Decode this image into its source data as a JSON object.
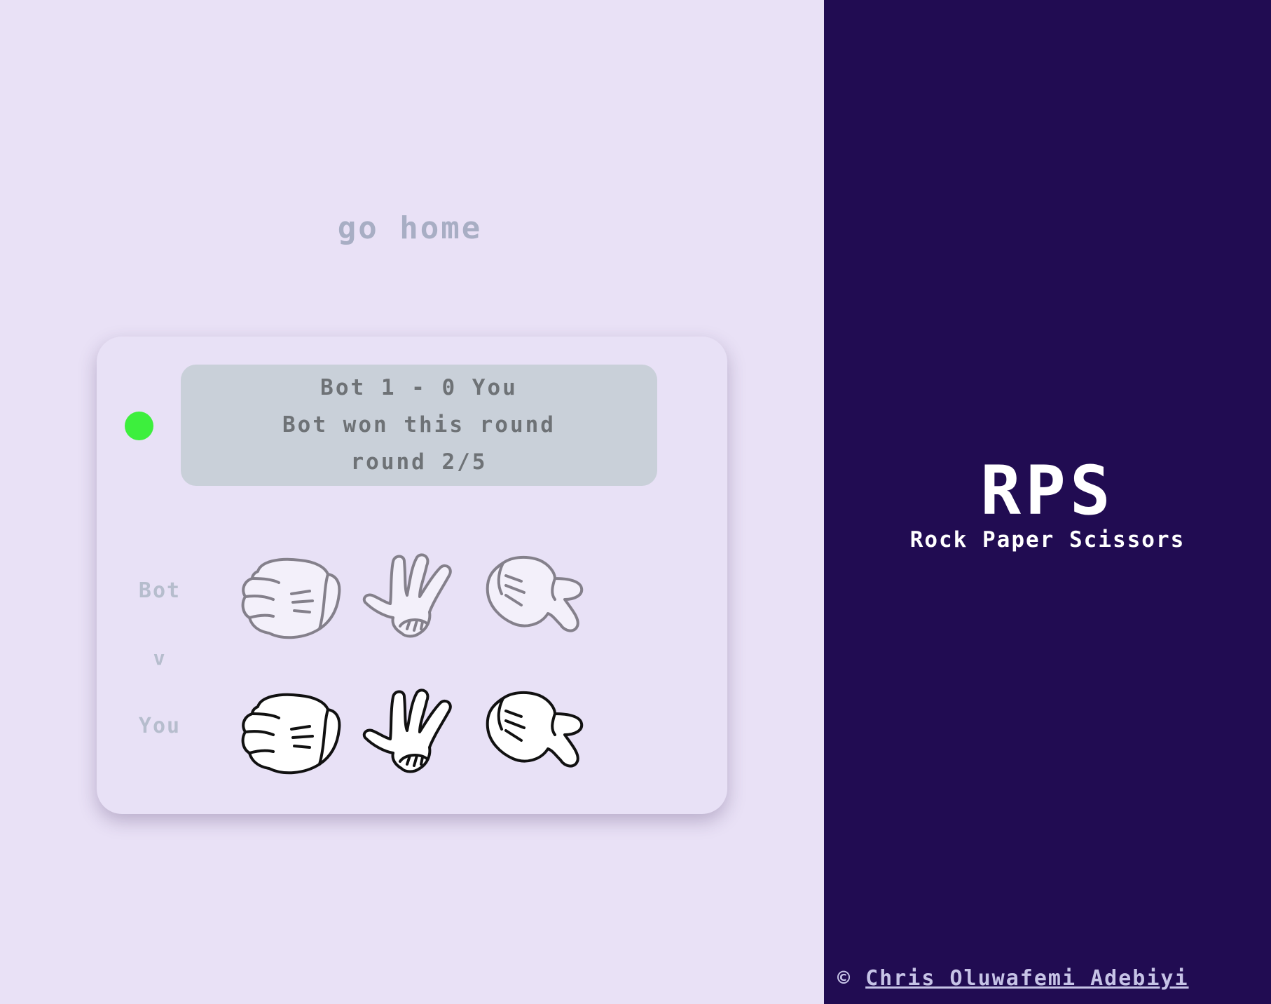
{
  "nav": {
    "go_home_label": "go home"
  },
  "scoreboard": {
    "score_line": "Bot 1 - 0 You",
    "result_line": "Bot won this round",
    "round_line": "round 2/5",
    "status_color": "#3def3d"
  },
  "players": {
    "bot_label": "Bot",
    "versus_label": "v",
    "you_label": "You"
  },
  "choices": [
    {
      "name": "rock",
      "icon": "rock-glove-icon"
    },
    {
      "name": "paper",
      "icon": "paper-glove-icon"
    },
    {
      "name": "scissors",
      "icon": "scissors-glove-icon"
    }
  ],
  "brand": {
    "title": "RPS",
    "subtitle": "Rock Paper Scissors"
  },
  "footer": {
    "copyright_symbol": "©",
    "author_name": "Chris Oluwafemi Adebiyi"
  },
  "colors": {
    "left_background": "#e9e1f6",
    "right_background": "#210c52",
    "scoreboard_background": "#c9d0d9"
  }
}
